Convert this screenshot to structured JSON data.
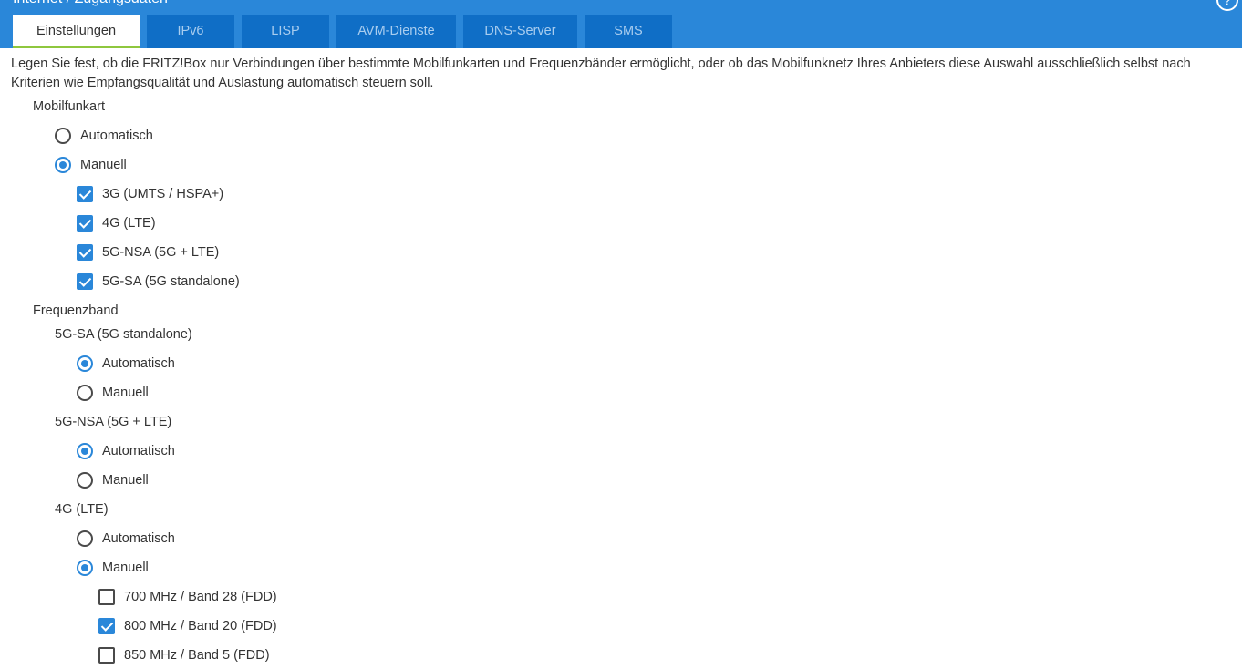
{
  "header": {
    "title": "Internet / Zugangsdaten",
    "help_icon": "help-icon"
  },
  "tabs": [
    {
      "label": "Einstellungen",
      "active": true
    },
    {
      "label": "IPv6",
      "active": false
    },
    {
      "label": "LISP",
      "active": false
    },
    {
      "label": "AVM-Dienste",
      "active": false
    },
    {
      "label": "DNS-Server",
      "active": false
    },
    {
      "label": "SMS",
      "active": false
    }
  ],
  "description": "Legen Sie fest, ob die FRITZ!Box nur Verbindungen über bestimmte Mobilfunkarten und Frequenzbänder ermöglicht, oder ob das Mobilfunknetz Ihres Anbieters diese Auswahl ausschließlich selbst nach Kriterien wie Empfangsqualität und Auslastung automatisch steuern soll.",
  "mobilfunkart": {
    "label": "Mobilfunkart",
    "options": [
      {
        "label": "Automatisch",
        "selected": false
      },
      {
        "label": "Manuell",
        "selected": true
      }
    ],
    "types": [
      {
        "label": "3G (UMTS / HSPA+)",
        "checked": true
      },
      {
        "label": "4G (LTE)",
        "checked": true
      },
      {
        "label": "5G-NSA (5G + LTE)",
        "checked": true
      },
      {
        "label": "5G-SA (5G standalone)",
        "checked": true
      }
    ]
  },
  "frequenzband": {
    "label": "Frequenzband",
    "groups": [
      {
        "label": "5G-SA (5G standalone)",
        "options": [
          {
            "label": "Automatisch",
            "selected": true
          },
          {
            "label": "Manuell",
            "selected": false
          }
        ]
      },
      {
        "label": "5G-NSA (5G + LTE)",
        "options": [
          {
            "label": "Automatisch",
            "selected": true
          },
          {
            "label": "Manuell",
            "selected": false
          }
        ]
      },
      {
        "label": "4G (LTE)",
        "options": [
          {
            "label": "Automatisch",
            "selected": false
          },
          {
            "label": "Manuell",
            "selected": true
          }
        ],
        "bands": [
          {
            "label": "700 MHz / Band 28 (FDD)",
            "checked": false
          },
          {
            "label": "800 MHz / Band 20 (FDD)",
            "checked": true
          },
          {
            "label": "850 MHz / Band 5 (FDD)",
            "checked": false
          }
        ]
      }
    ]
  },
  "colors": {
    "header": "#2a87d9",
    "tab": "#0f6ec6",
    "tab_text": "#a9cdef",
    "accent": "#2a87d9",
    "active_tab_underline": "#8ec73e"
  }
}
